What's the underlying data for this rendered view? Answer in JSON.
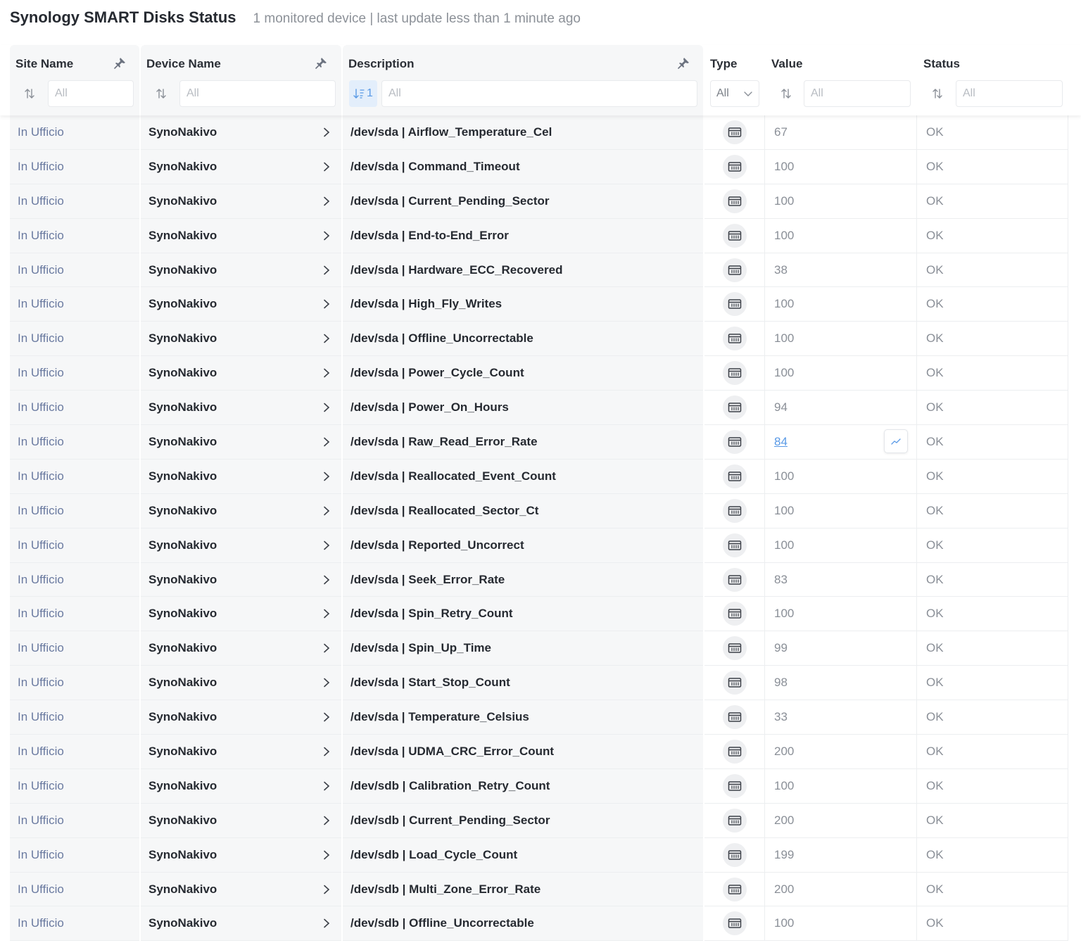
{
  "page": {
    "title": "Synology SMART Disks Status",
    "subtitle": "1 monitored device | last update less than 1 minute ago"
  },
  "columns": {
    "site": {
      "label": "Site Name",
      "filter_placeholder": "All"
    },
    "device": {
      "label": "Device Name",
      "filter_placeholder": "All"
    },
    "description": {
      "label": "Description",
      "filter_placeholder": "All",
      "sort_order": "1"
    },
    "type": {
      "label": "Type",
      "select_value": "All"
    },
    "value": {
      "label": "Value",
      "filter_placeholder": "All"
    },
    "status": {
      "label": "Status",
      "filter_placeholder": "All"
    }
  },
  "icons": {
    "pin": "pin-icon",
    "sort": "sort-icon",
    "sort_active": "sort-ascending-icon",
    "chevron": "chevron-right-icon",
    "type": "gauge-icon",
    "trend": "trend-chart-icon"
  },
  "colors": {
    "link": "#5a9ae6",
    "site_text": "#6a7aa0",
    "pinned_bg": "#f6f7f8"
  },
  "rows": [
    {
      "site": "In Ufficio",
      "device": "SynoNakivo",
      "description": "/dev/sda | Airflow_Temperature_Cel",
      "value": "67",
      "status": "OK"
    },
    {
      "site": "In Ufficio",
      "device": "SynoNakivo",
      "description": "/dev/sda | Command_Timeout",
      "value": "100",
      "status": "OK"
    },
    {
      "site": "In Ufficio",
      "device": "SynoNakivo",
      "description": "/dev/sda | Current_Pending_Sector",
      "value": "100",
      "status": "OK"
    },
    {
      "site": "In Ufficio",
      "device": "SynoNakivo",
      "description": "/dev/sda | End-to-End_Error",
      "value": "100",
      "status": "OK"
    },
    {
      "site": "In Ufficio",
      "device": "SynoNakivo",
      "description": "/dev/sda | Hardware_ECC_Recovered",
      "value": "38",
      "status": "OK"
    },
    {
      "site": "In Ufficio",
      "device": "SynoNakivo",
      "description": "/dev/sda | High_Fly_Writes",
      "value": "100",
      "status": "OK"
    },
    {
      "site": "In Ufficio",
      "device": "SynoNakivo",
      "description": "/dev/sda | Offline_Uncorrectable",
      "value": "100",
      "status": "OK"
    },
    {
      "site": "In Ufficio",
      "device": "SynoNakivo",
      "description": "/dev/sda | Power_Cycle_Count",
      "value": "100",
      "status": "OK"
    },
    {
      "site": "In Ufficio",
      "device": "SynoNakivo",
      "description": "/dev/sda | Power_On_Hours",
      "value": "94",
      "status": "OK"
    },
    {
      "site": "In Ufficio",
      "device": "SynoNakivo",
      "description": "/dev/sda | Raw_Read_Error_Rate",
      "value": "84",
      "status": "OK",
      "hovered": true
    },
    {
      "site": "In Ufficio",
      "device": "SynoNakivo",
      "description": "/dev/sda | Reallocated_Event_Count",
      "value": "100",
      "status": "OK"
    },
    {
      "site": "In Ufficio",
      "device": "SynoNakivo",
      "description": "/dev/sda | Reallocated_Sector_Ct",
      "value": "100",
      "status": "OK"
    },
    {
      "site": "In Ufficio",
      "device": "SynoNakivo",
      "description": "/dev/sda | Reported_Uncorrect",
      "value": "100",
      "status": "OK"
    },
    {
      "site": "In Ufficio",
      "device": "SynoNakivo",
      "description": "/dev/sda | Seek_Error_Rate",
      "value": "83",
      "status": "OK"
    },
    {
      "site": "In Ufficio",
      "device": "SynoNakivo",
      "description": "/dev/sda | Spin_Retry_Count",
      "value": "100",
      "status": "OK"
    },
    {
      "site": "In Ufficio",
      "device": "SynoNakivo",
      "description": "/dev/sda | Spin_Up_Time",
      "value": "99",
      "status": "OK"
    },
    {
      "site": "In Ufficio",
      "device": "SynoNakivo",
      "description": "/dev/sda | Start_Stop_Count",
      "value": "98",
      "status": "OK"
    },
    {
      "site": "In Ufficio",
      "device": "SynoNakivo",
      "description": "/dev/sda | Temperature_Celsius",
      "value": "33",
      "status": "OK"
    },
    {
      "site": "In Ufficio",
      "device": "SynoNakivo",
      "description": "/dev/sda | UDMA_CRC_Error_Count",
      "value": "200",
      "status": "OK"
    },
    {
      "site": "In Ufficio",
      "device": "SynoNakivo",
      "description": "/dev/sdb | Calibration_Retry_Count",
      "value": "100",
      "status": "OK"
    },
    {
      "site": "In Ufficio",
      "device": "SynoNakivo",
      "description": "/dev/sdb | Current_Pending_Sector",
      "value": "200",
      "status": "OK"
    },
    {
      "site": "In Ufficio",
      "device": "SynoNakivo",
      "description": "/dev/sdb | Load_Cycle_Count",
      "value": "199",
      "status": "OK"
    },
    {
      "site": "In Ufficio",
      "device": "SynoNakivo",
      "description": "/dev/sdb | Multi_Zone_Error_Rate",
      "value": "200",
      "status": "OK"
    },
    {
      "site": "In Ufficio",
      "device": "SynoNakivo",
      "description": "/dev/sdb | Offline_Uncorrectable",
      "value": "100",
      "status": "OK"
    }
  ]
}
